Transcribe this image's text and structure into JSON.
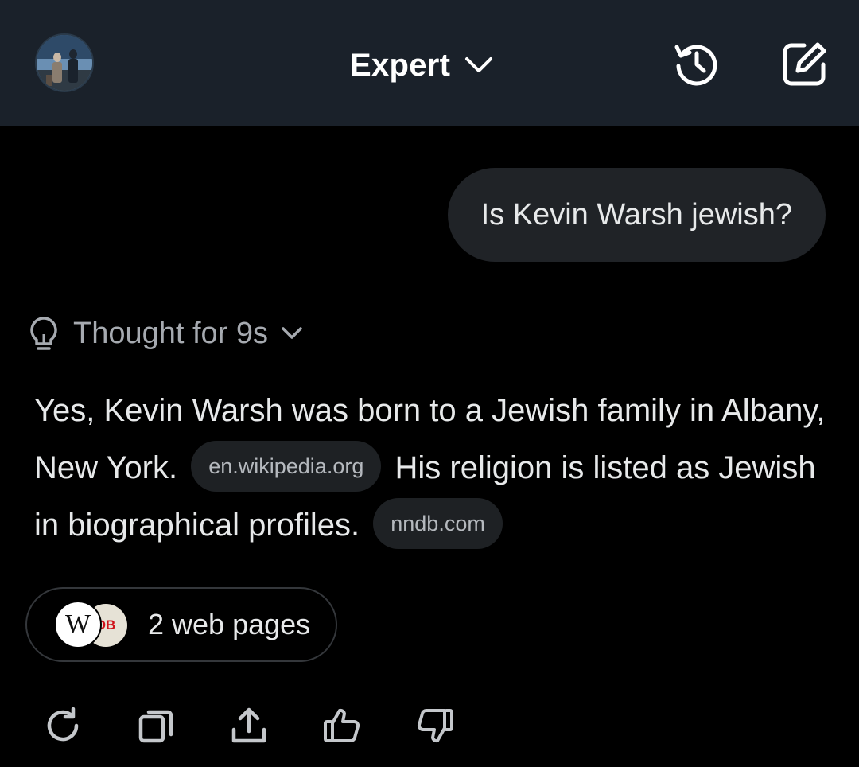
{
  "header": {
    "mode_label": "Expert",
    "icons": {
      "avatar": "avatar-image",
      "mode": "chevron-down-icon",
      "history": "history-icon",
      "new_chat": "new-chat-edit-icon"
    }
  },
  "conversation": {
    "user_message": "Is Kevin Warsh jewish?",
    "thought": {
      "label": "Thought for 9s",
      "icon": "lightbulb-icon"
    },
    "answer": {
      "part1": "Yes, Kevin Warsh was born to a Jewish family in Albany, New York.",
      "source1": "en.wikipedia.org",
      "part2": "His religion is listed as Jewish in biographical profiles.",
      "source2": "nndb.com"
    },
    "web_pages": {
      "label": "2 web pages",
      "favicon1_text": "W",
      "favicon2_text": "DB"
    }
  },
  "actions": [
    "regenerate-icon",
    "copy-icon",
    "share-icon",
    "thumbs-up-icon",
    "thumbs-down-icon"
  ],
  "colors": {
    "header_bg": "#1a212a",
    "bubble_bg": "#202327",
    "chip_bg": "#1e2124",
    "text": "#e7e9ea",
    "muted": "#a6aab0"
  }
}
